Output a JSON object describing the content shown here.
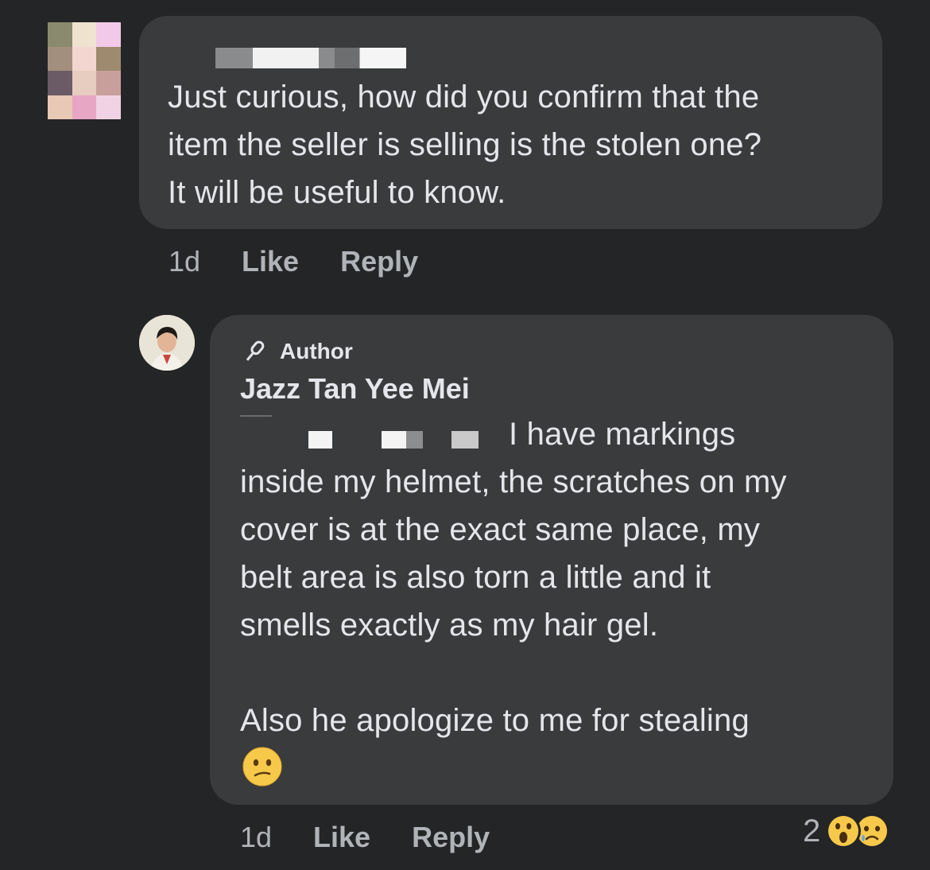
{
  "comment1": {
    "text": "Just curious, how did you confirm that the\nitem the seller is selling is the stolen one?\nIt will be useful to know.",
    "time": "1d",
    "like_label": "Like",
    "reply_label": "Reply"
  },
  "comment2": {
    "badge": "Author",
    "author_name": "Jazz Tan Yee Mei",
    "text_line1": "I have markings",
    "text_rest": "inside my helmet, the scratches on my\ncover is at the exact same place, my\nbelt area is also torn a little and it\nsmells exactly as my hair gel.\n\nAlso he apologize to me for stealing",
    "emoji": "confused-face",
    "time": "1d",
    "like_label": "Like",
    "reply_label": "Reply",
    "reaction_count": "2",
    "reactions": [
      "wow",
      "sad"
    ]
  },
  "colors": {
    "background": "#242526",
    "bubble": "#3a3b3c",
    "primary_text": "#e4e6eb",
    "secondary_text": "#b0b3b8"
  }
}
